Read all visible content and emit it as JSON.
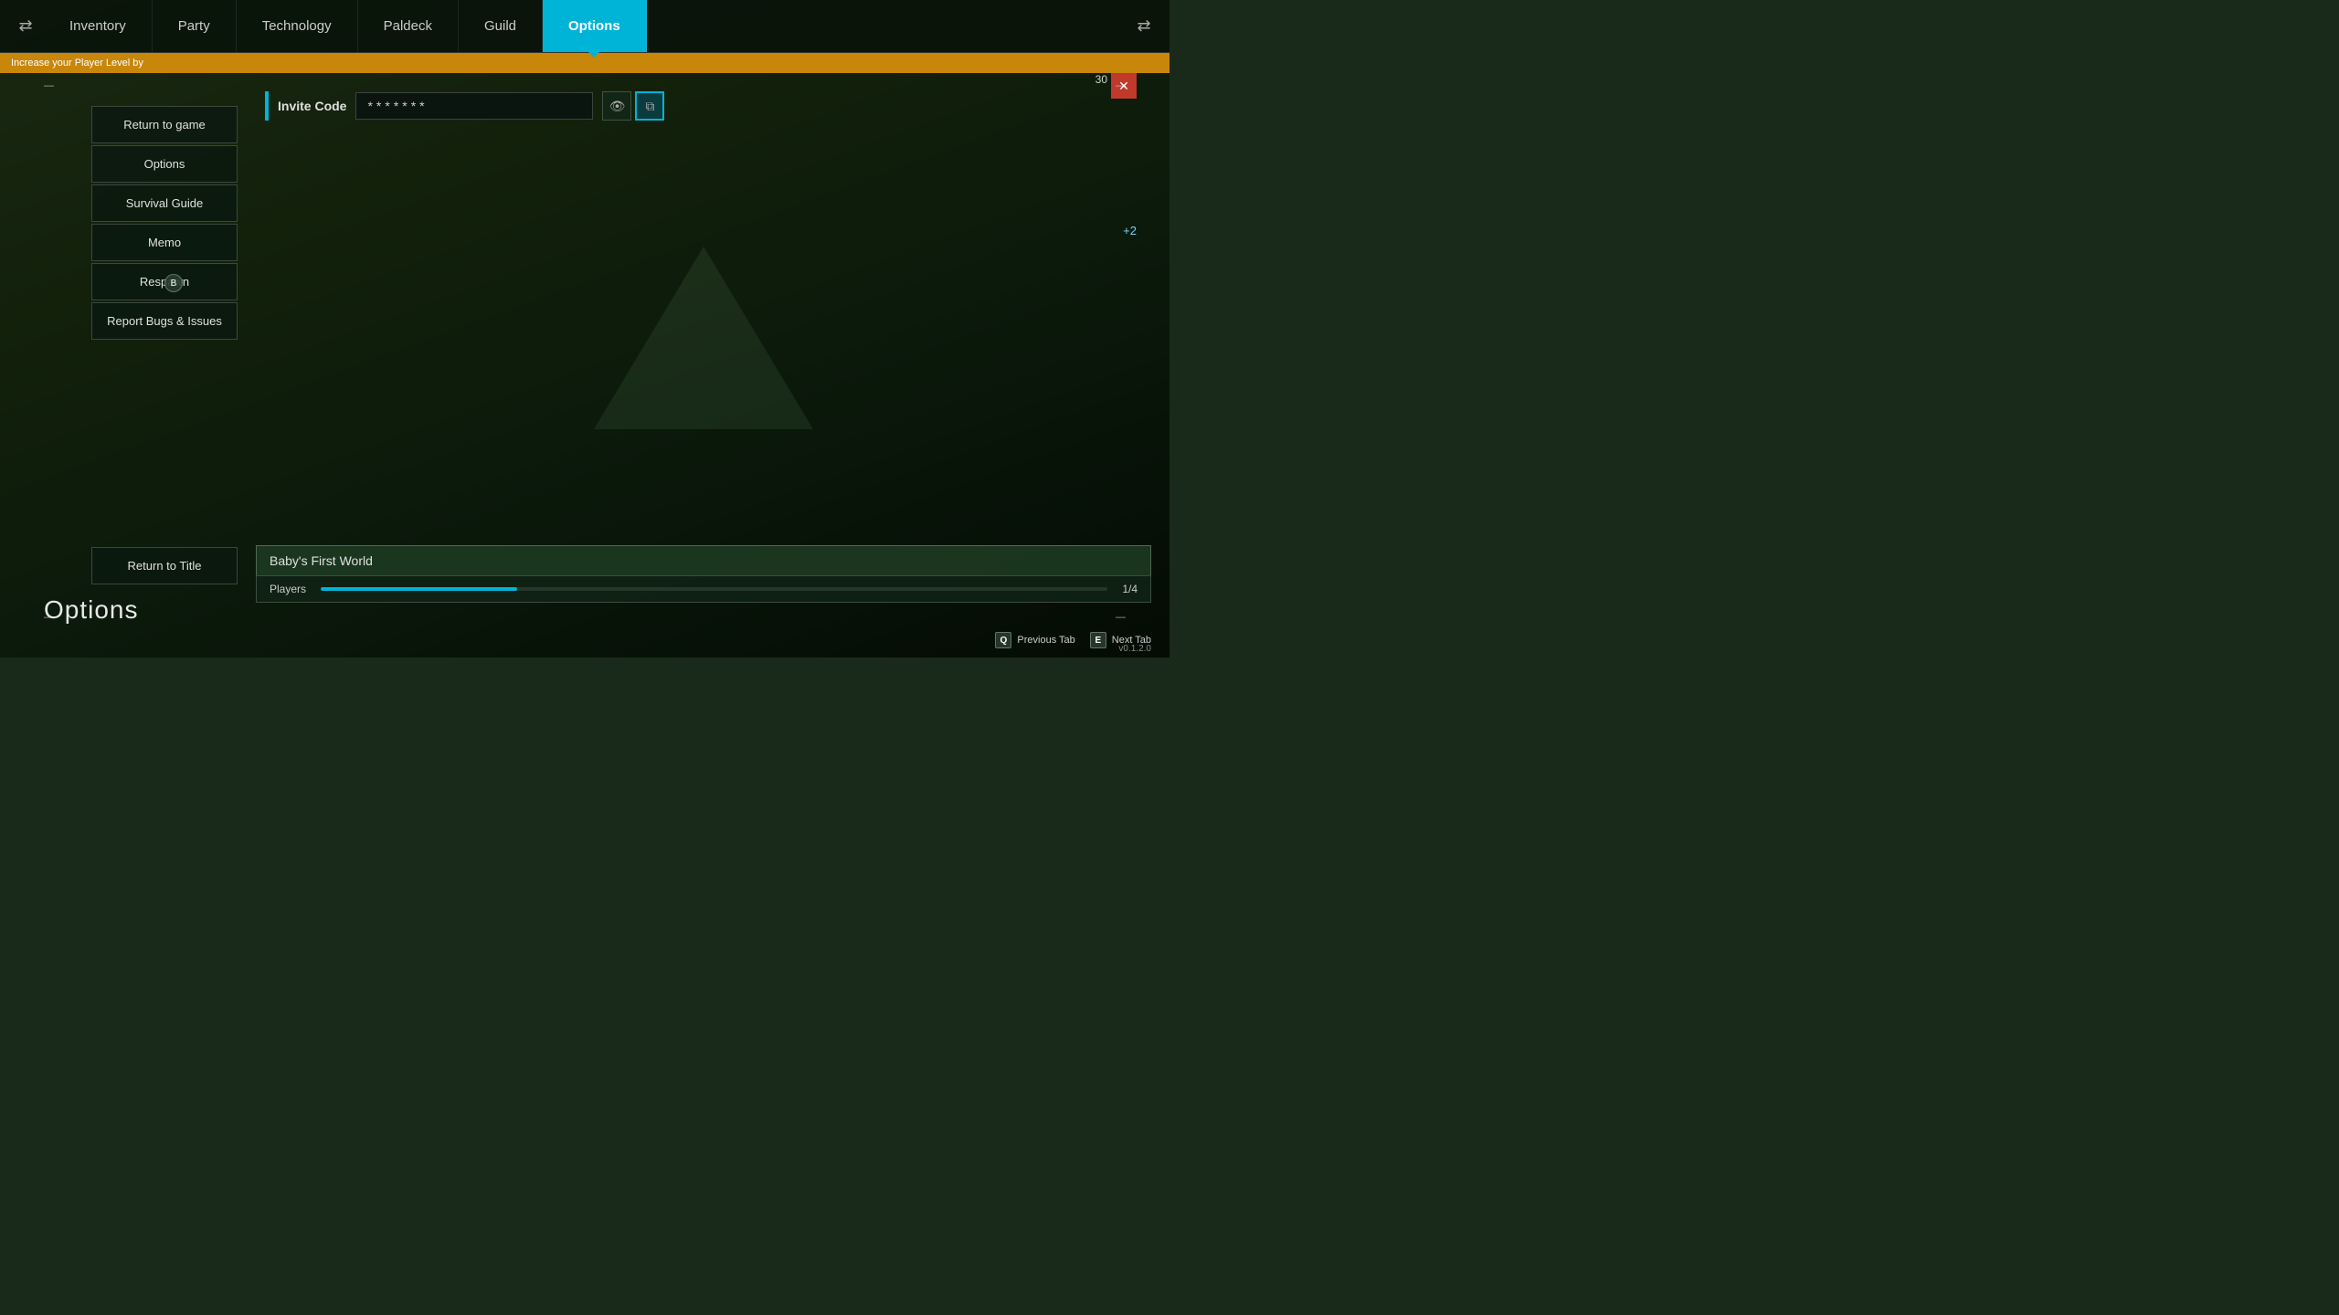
{
  "nav": {
    "swap_left_icon": "⇄",
    "swap_right_icon": "⇄",
    "tabs": [
      {
        "id": "inventory",
        "label": "Inventory",
        "active": false
      },
      {
        "id": "party",
        "label": "Party",
        "active": false
      },
      {
        "id": "technology",
        "label": "Technology",
        "active": false
      },
      {
        "id": "paldeck",
        "label": "Paldeck",
        "active": false
      },
      {
        "id": "guild",
        "label": "Guild",
        "active": false
      },
      {
        "id": "options",
        "label": "Options",
        "active": true
      }
    ]
  },
  "notification": {
    "text": "Increase your Player Level by"
  },
  "menu": {
    "return_to_game": "Return to game",
    "options": "Options",
    "survival_guide": "Survival Guide",
    "memo": "Memo",
    "respawn": "Respawn",
    "report_bugs": "Report Bugs & Issues",
    "return_to_title": "Return to Title"
  },
  "invite_code": {
    "label": "Invite Code",
    "value": "*******",
    "hide_icon": "👁",
    "copy_icon": "⧉"
  },
  "world": {
    "name": "Baby's First World",
    "players_label": "Players",
    "players_count": "1/4",
    "players_fill_pct": 25
  },
  "page_title": "Options",
  "bottom_nav": {
    "prev_tab_key": "Q",
    "prev_tab_label": "Previous Tab",
    "next_tab_key": "E",
    "next_tab_label": "Next Tab"
  },
  "version": "v0.1.2.0",
  "hp_badge": "30",
  "plus_badge": "+2",
  "b_button": "B"
}
